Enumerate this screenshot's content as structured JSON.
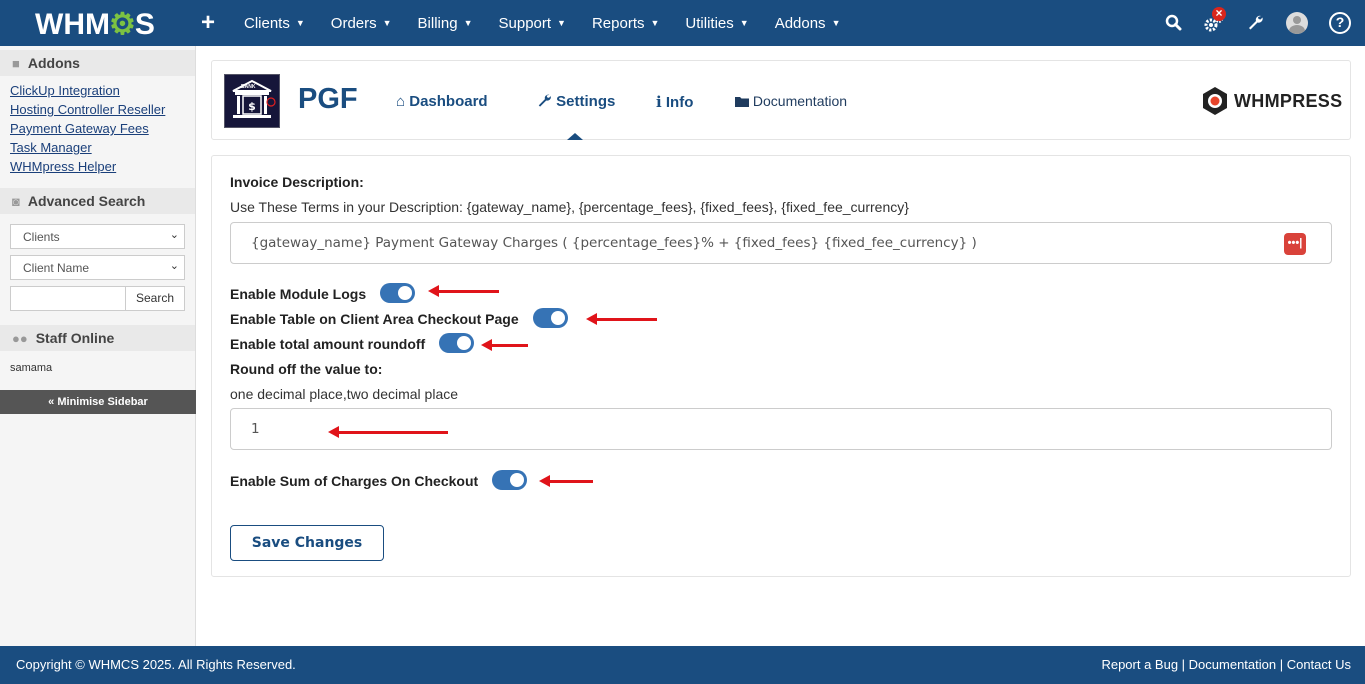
{
  "topbar": {
    "logo_left": "WHM",
    "logo_gear": "⚙",
    "logo_right": "S",
    "add_icon": "+",
    "menu": [
      {
        "label": "Clients"
      },
      {
        "label": "Orders"
      },
      {
        "label": "Billing"
      },
      {
        "label": "Support"
      },
      {
        "label": "Reports"
      },
      {
        "label": "Utilities"
      },
      {
        "label": "Addons"
      }
    ],
    "icons": [
      "search-icon",
      "automation-gear-icon",
      "wrench-icon",
      "user-avatar",
      "help-icon"
    ],
    "alert_badge": "×"
  },
  "sidebar": {
    "addons_title": "Addons",
    "addons": [
      {
        "label": "ClickUp Integration"
      },
      {
        "label": "Hosting Controller Reseller"
      },
      {
        "label": "Payment Gateway Fees"
      },
      {
        "label": "Task Manager"
      },
      {
        "label": "WHMpress Helper"
      }
    ],
    "advanced_search_title": "Advanced Search",
    "search_type": "Clients",
    "search_field": "Client Name",
    "search_value": "",
    "search_button": "Search",
    "staff_title": "Staff Online",
    "staff": [
      "samama"
    ],
    "minimise": "« Minimise Sidebar"
  },
  "module": {
    "name": "PGF",
    "nav": [
      {
        "label": "Dashboard",
        "icon": "home-icon"
      },
      {
        "label": "Settings",
        "icon": "wrench-icon"
      },
      {
        "label": "Info",
        "icon": "info-icon"
      },
      {
        "label": "Documentation",
        "icon": "folder-icon"
      }
    ],
    "active_tab": "Settings",
    "brand": "WHMPRESS",
    "logo_text": "BANK"
  },
  "settings": {
    "invoice_description_label": "Invoice Description:",
    "invoice_description_help": "Use These Terms in your Description: {gateway_name}, {percentage_fees}, {fixed_fees}, {fixed_fee_currency}",
    "invoice_description_value": "{gateway_name} Payment Gateway Charges ( {percentage_fees}% + {fixed_fees} {fixed_fee_currency} )",
    "enable_module_logs_label": "Enable Module Logs",
    "enable_module_logs": true,
    "enable_table_checkout_label": "Enable Table on Client Area Checkout Page",
    "enable_table_checkout": true,
    "enable_roundoff_label": "Enable total amount roundoff",
    "enable_roundoff": true,
    "round_off_label": "Round off the value to:",
    "round_off_help": "one decimal place,two decimal place",
    "round_off_value": "1",
    "enable_sum_charges_label": "Enable Sum of Charges On Checkout",
    "enable_sum_charges": true,
    "save_button": "Save Changes",
    "password_manager_icon": "•••|"
  },
  "footer": {
    "copyright": "Copyright © WHMCS 2025. All Rights Reserved.",
    "links": "Report a Bug | Documentation | Contact Us"
  },
  "colors": {
    "brand_blue": "#1a4d80",
    "toggle_on": "#3673b5",
    "annotation_red": "#e0141a"
  }
}
